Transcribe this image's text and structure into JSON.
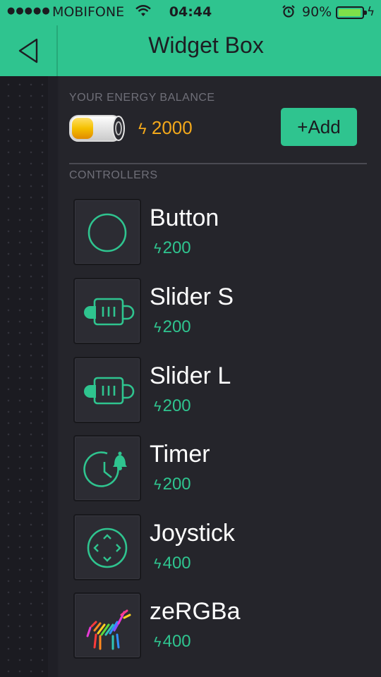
{
  "status_bar": {
    "signal": "●●●●●",
    "carrier": "MOBIFONE",
    "time": "04:44",
    "battery_percent": "90%",
    "battery_level": 0.9,
    "charging_icon": "bolt-icon"
  },
  "header": {
    "title": "Widget Box",
    "back_icon": "back-triangle-icon"
  },
  "energy": {
    "label": "YOUR ENERGY BALANCE",
    "value": "2000",
    "energy_symbol": "ϟ",
    "add_label": "+Add"
  },
  "controllers": {
    "label": "CONTROLLERS",
    "items": [
      {
        "name": "Button",
        "cost": "200",
        "icon": "button-circle-icon"
      },
      {
        "name": "Slider S",
        "cost": "200",
        "icon": "slider-icon"
      },
      {
        "name": "Slider L",
        "cost": "200",
        "icon": "slider-icon"
      },
      {
        "name": "Timer",
        "cost": "200",
        "icon": "timer-clock-icon"
      },
      {
        "name": "Joystick",
        "cost": "400",
        "icon": "joystick-icon"
      },
      {
        "name": "zeRGBa",
        "cost": "400",
        "icon": "zebra-rgb-icon"
      }
    ]
  },
  "colors": {
    "accent": "#2fc48f",
    "energy": "#f2a81b",
    "background": "#25252b"
  }
}
